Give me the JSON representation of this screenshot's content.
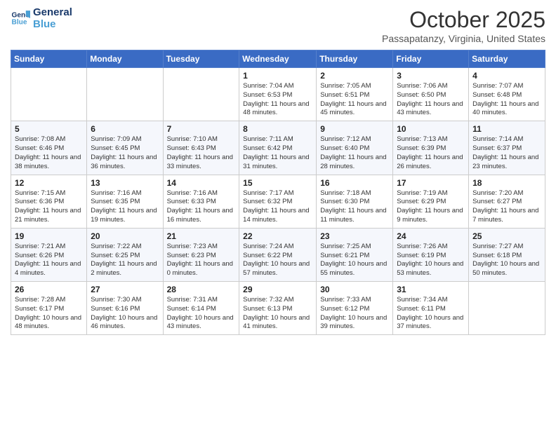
{
  "header": {
    "logo_line1": "General",
    "logo_line2": "Blue",
    "month": "October 2025",
    "location": "Passapatanzy, Virginia, United States"
  },
  "weekdays": [
    "Sunday",
    "Monday",
    "Tuesday",
    "Wednesday",
    "Thursday",
    "Friday",
    "Saturday"
  ],
  "weeks": [
    [
      {
        "day": "",
        "info": ""
      },
      {
        "day": "",
        "info": ""
      },
      {
        "day": "",
        "info": ""
      },
      {
        "day": "1",
        "info": "Sunrise: 7:04 AM\nSunset: 6:53 PM\nDaylight: 11 hours and 48 minutes."
      },
      {
        "day": "2",
        "info": "Sunrise: 7:05 AM\nSunset: 6:51 PM\nDaylight: 11 hours and 45 minutes."
      },
      {
        "day": "3",
        "info": "Sunrise: 7:06 AM\nSunset: 6:50 PM\nDaylight: 11 hours and 43 minutes."
      },
      {
        "day": "4",
        "info": "Sunrise: 7:07 AM\nSunset: 6:48 PM\nDaylight: 11 hours and 40 minutes."
      }
    ],
    [
      {
        "day": "5",
        "info": "Sunrise: 7:08 AM\nSunset: 6:46 PM\nDaylight: 11 hours and 38 minutes."
      },
      {
        "day": "6",
        "info": "Sunrise: 7:09 AM\nSunset: 6:45 PM\nDaylight: 11 hours and 36 minutes."
      },
      {
        "day": "7",
        "info": "Sunrise: 7:10 AM\nSunset: 6:43 PM\nDaylight: 11 hours and 33 minutes."
      },
      {
        "day": "8",
        "info": "Sunrise: 7:11 AM\nSunset: 6:42 PM\nDaylight: 11 hours and 31 minutes."
      },
      {
        "day": "9",
        "info": "Sunrise: 7:12 AM\nSunset: 6:40 PM\nDaylight: 11 hours and 28 minutes."
      },
      {
        "day": "10",
        "info": "Sunrise: 7:13 AM\nSunset: 6:39 PM\nDaylight: 11 hours and 26 minutes."
      },
      {
        "day": "11",
        "info": "Sunrise: 7:14 AM\nSunset: 6:37 PM\nDaylight: 11 hours and 23 minutes."
      }
    ],
    [
      {
        "day": "12",
        "info": "Sunrise: 7:15 AM\nSunset: 6:36 PM\nDaylight: 11 hours and 21 minutes."
      },
      {
        "day": "13",
        "info": "Sunrise: 7:16 AM\nSunset: 6:35 PM\nDaylight: 11 hours and 19 minutes."
      },
      {
        "day": "14",
        "info": "Sunrise: 7:16 AM\nSunset: 6:33 PM\nDaylight: 11 hours and 16 minutes."
      },
      {
        "day": "15",
        "info": "Sunrise: 7:17 AM\nSunset: 6:32 PM\nDaylight: 11 hours and 14 minutes."
      },
      {
        "day": "16",
        "info": "Sunrise: 7:18 AM\nSunset: 6:30 PM\nDaylight: 11 hours and 11 minutes."
      },
      {
        "day": "17",
        "info": "Sunrise: 7:19 AM\nSunset: 6:29 PM\nDaylight: 11 hours and 9 minutes."
      },
      {
        "day": "18",
        "info": "Sunrise: 7:20 AM\nSunset: 6:27 PM\nDaylight: 11 hours and 7 minutes."
      }
    ],
    [
      {
        "day": "19",
        "info": "Sunrise: 7:21 AM\nSunset: 6:26 PM\nDaylight: 11 hours and 4 minutes."
      },
      {
        "day": "20",
        "info": "Sunrise: 7:22 AM\nSunset: 6:25 PM\nDaylight: 11 hours and 2 minutes."
      },
      {
        "day": "21",
        "info": "Sunrise: 7:23 AM\nSunset: 6:23 PM\nDaylight: 11 hours and 0 minutes."
      },
      {
        "day": "22",
        "info": "Sunrise: 7:24 AM\nSunset: 6:22 PM\nDaylight: 10 hours and 57 minutes."
      },
      {
        "day": "23",
        "info": "Sunrise: 7:25 AM\nSunset: 6:21 PM\nDaylight: 10 hours and 55 minutes."
      },
      {
        "day": "24",
        "info": "Sunrise: 7:26 AM\nSunset: 6:19 PM\nDaylight: 10 hours and 53 minutes."
      },
      {
        "day": "25",
        "info": "Sunrise: 7:27 AM\nSunset: 6:18 PM\nDaylight: 10 hours and 50 minutes."
      }
    ],
    [
      {
        "day": "26",
        "info": "Sunrise: 7:28 AM\nSunset: 6:17 PM\nDaylight: 10 hours and 48 minutes."
      },
      {
        "day": "27",
        "info": "Sunrise: 7:30 AM\nSunset: 6:16 PM\nDaylight: 10 hours and 46 minutes."
      },
      {
        "day": "28",
        "info": "Sunrise: 7:31 AM\nSunset: 6:14 PM\nDaylight: 10 hours and 43 minutes."
      },
      {
        "day": "29",
        "info": "Sunrise: 7:32 AM\nSunset: 6:13 PM\nDaylight: 10 hours and 41 minutes."
      },
      {
        "day": "30",
        "info": "Sunrise: 7:33 AM\nSunset: 6:12 PM\nDaylight: 10 hours and 39 minutes."
      },
      {
        "day": "31",
        "info": "Sunrise: 7:34 AM\nSunset: 6:11 PM\nDaylight: 10 hours and 37 minutes."
      },
      {
        "day": "",
        "info": ""
      }
    ]
  ]
}
